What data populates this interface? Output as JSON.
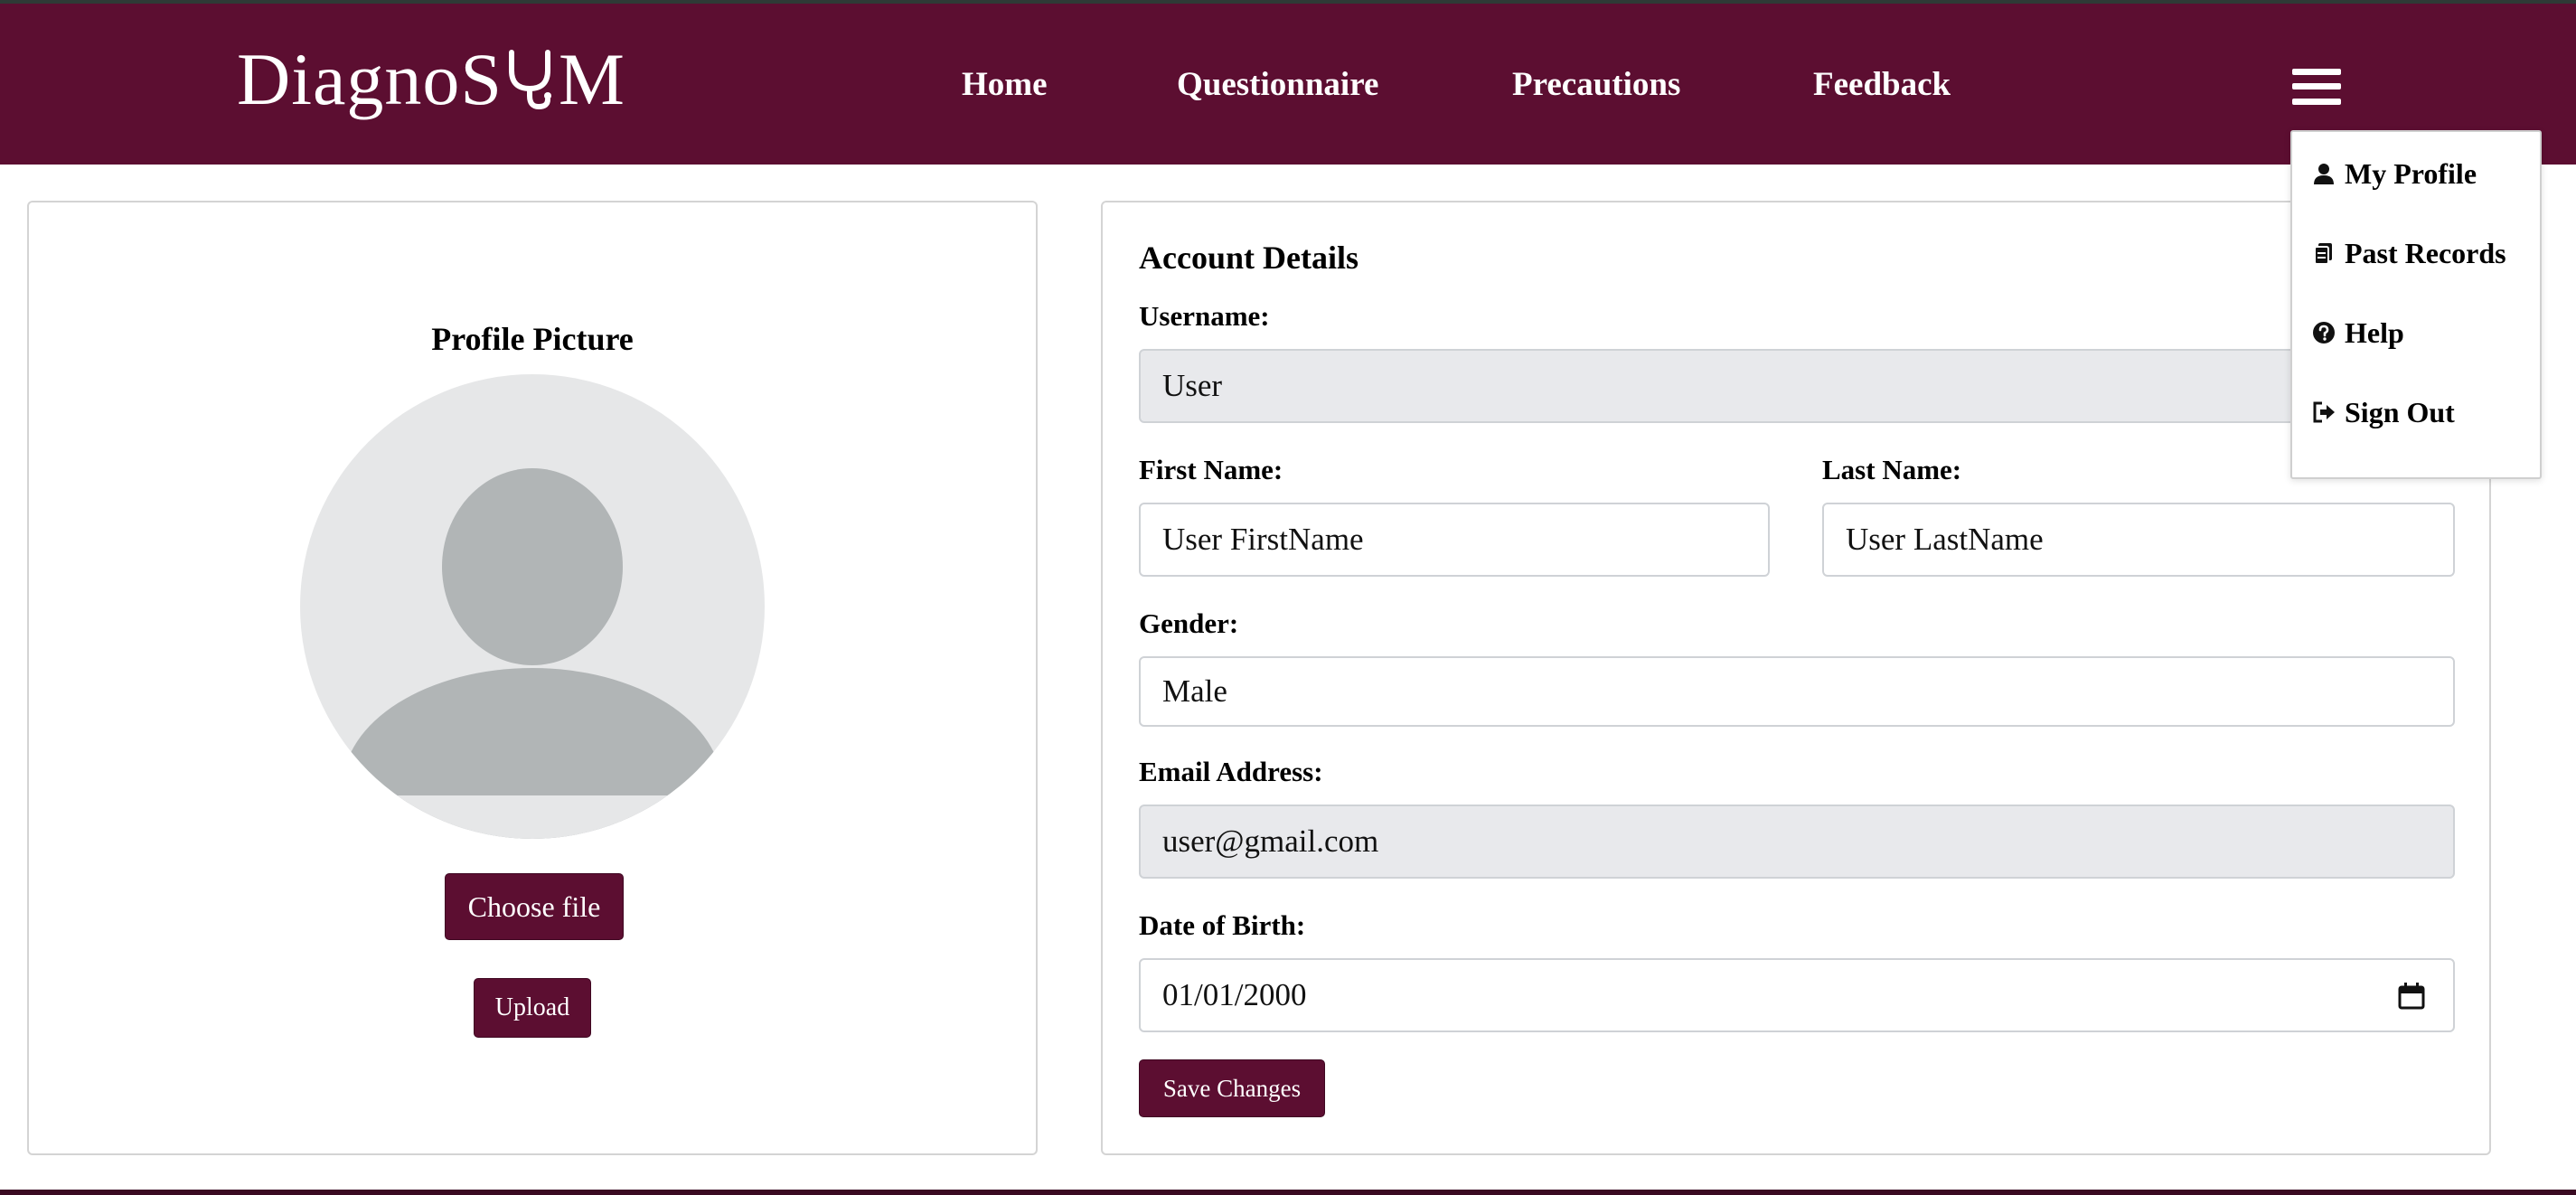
{
  "brand": {
    "logo_prefix": "DiagnoS",
    "logo_suffix": "M"
  },
  "nav": {
    "links": [
      "Home",
      "Questionnaire",
      "Precautions",
      "Feedback"
    ]
  },
  "menu": {
    "items": [
      {
        "label": "My Profile",
        "icon": "user-icon"
      },
      {
        "label": "Past Records",
        "icon": "records-icon"
      },
      {
        "label": "Help",
        "icon": "help-icon"
      },
      {
        "label": "Sign Out",
        "icon": "sign-out-icon"
      }
    ]
  },
  "profile_picture": {
    "title": "Profile Picture",
    "choose_file_label": "Choose file",
    "upload_label": "Upload"
  },
  "account": {
    "title": "Account Details",
    "username_label": "Username:",
    "username_value": "User",
    "first_name_label": "First Name:",
    "first_name_value": "User FirstName",
    "last_name_label": "Last Name:",
    "last_name_value": "User LastName",
    "gender_label": "Gender:",
    "gender_value": "Male",
    "email_label": "Email Address:",
    "email_value": "user@gmail.com",
    "dob_label": "Date of Birth:",
    "dob_value": "01/01/2000",
    "save_label": "Save Changes"
  },
  "colors": {
    "brand": "#5c0e31",
    "readonly_field_bg": "#e8e9ec",
    "avatar_bg": "#e6e7e8",
    "avatar_fg": "#b1b5b6"
  }
}
